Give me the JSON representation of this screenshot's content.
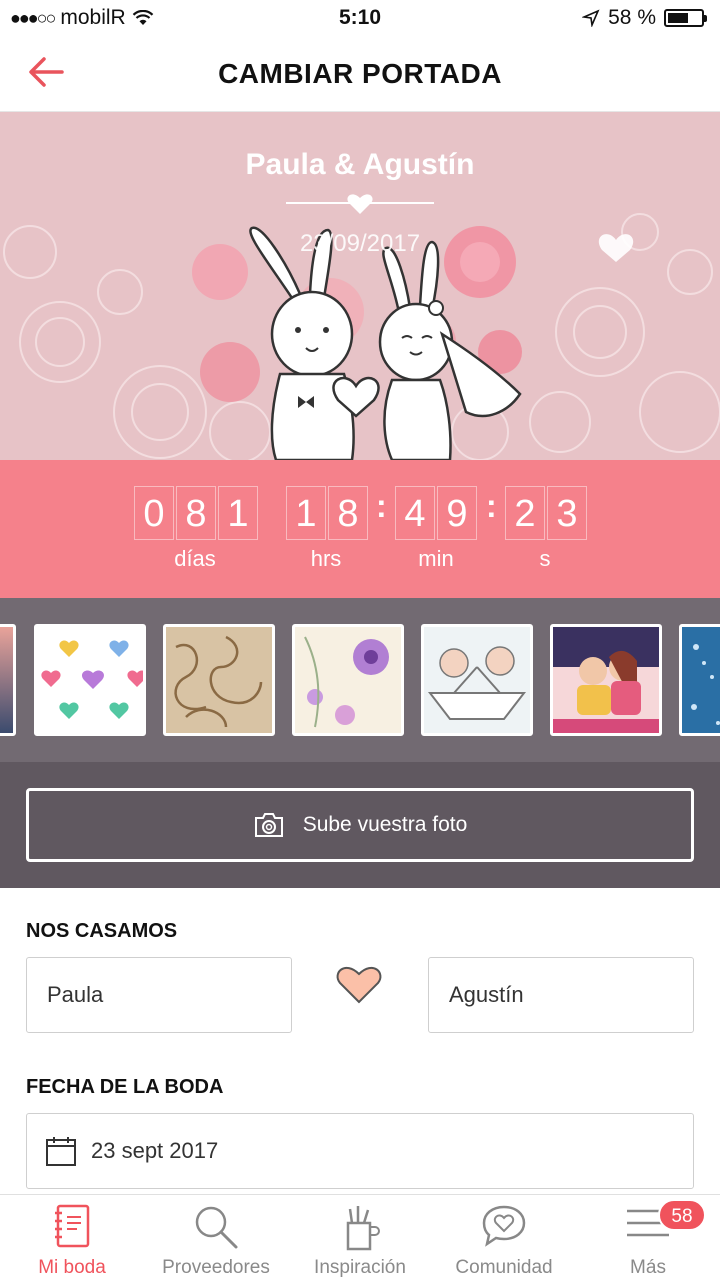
{
  "status_bar": {
    "carrier": "mobilR",
    "time": "5:10",
    "battery": "58 %"
  },
  "header": {
    "title": "CAMBIAR PORTADA"
  },
  "cover": {
    "names": "Paula & Agustín",
    "date": "23/09/2017"
  },
  "countdown": {
    "days": [
      "0",
      "8",
      "1"
    ],
    "hours": [
      "1",
      "8"
    ],
    "minutes": [
      "4",
      "9"
    ],
    "seconds": [
      "2",
      "3"
    ],
    "labels": {
      "days": "días",
      "hours": "hrs",
      "minutes": "min",
      "seconds": "s"
    }
  },
  "upload": {
    "label": "Sube vuestra foto"
  },
  "form": {
    "couple_label": "NOS CASAMOS",
    "partner1": "Paula",
    "partner2": "Agustín",
    "date_label": "FECHA DE LA BODA",
    "date_value": "23 sept 2017"
  },
  "nav": {
    "items": [
      {
        "label": "Mi boda",
        "icon": "notebook-icon"
      },
      {
        "label": "Proveedores",
        "icon": "search-icon"
      },
      {
        "label": "Inspiración",
        "icon": "pencil-cup-icon"
      },
      {
        "label": "Comunidad",
        "icon": "chat-heart-icon"
      },
      {
        "label": "Más",
        "icon": "menu-icon"
      }
    ],
    "badge": "58"
  },
  "colors": {
    "accent": "#f0535c",
    "countdown": "#f5818b",
    "cover": "#e7c3c7",
    "strip": "#726a72"
  }
}
